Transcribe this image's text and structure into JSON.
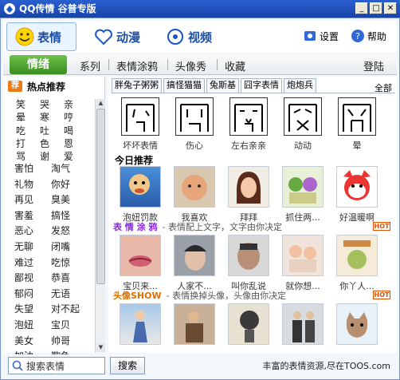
{
  "window": {
    "title": "QQ传情 谷普专版"
  },
  "nav": {
    "tabs": [
      "表情",
      "动漫",
      "视频"
    ],
    "settings": "设置",
    "help": "帮助"
  },
  "categories": {
    "active": "情绪",
    "items": [
      "系列",
      "表情涂鸦",
      "头像秀",
      "收藏"
    ],
    "login": "登陆"
  },
  "sidebar": {
    "badge": "荐",
    "title": "热点推荐",
    "grid3": [
      [
        "笑",
        "哭",
        "亲"
      ],
      [
        "晕",
        "寒",
        "哼"
      ],
      [
        "吃",
        "吐",
        "喝"
      ],
      [
        "打",
        "色",
        "恩"
      ],
      [
        "骂",
        "谢",
        "爱"
      ]
    ],
    "grid2": [
      [
        "害怕",
        "淘气"
      ],
      [
        "礼物",
        "你好"
      ],
      [
        "再见",
        "臭美"
      ],
      [
        "害羞",
        "搞怪"
      ],
      [
        "恶心",
        "发怒"
      ],
      [
        "无聊",
        "闭嘴"
      ],
      [
        "难过",
        "吃惊"
      ],
      [
        "鄙视",
        "恭喜"
      ],
      [
        "郁闷",
        "无语"
      ],
      [
        "失望",
        "对不起"
      ],
      [
        "泡妞",
        "宝贝"
      ],
      [
        "美女",
        "帅哥"
      ],
      [
        "加油",
        "欺负"
      ]
    ]
  },
  "content": {
    "subtabs": [
      "胖兔子粥粥",
      "搞怪猫猫",
      "兔斯基",
      "囧字表情",
      "炮炮兵"
    ],
    "all": "全部",
    "iconrow": [
      "坏坏表情",
      "伤心",
      "左右亲亲",
      "动动",
      "晕"
    ],
    "today_title": "今日推荐",
    "today": [
      "泡妞罚款",
      "我喜欢",
      "拜拜",
      "抓住两...",
      "好温暖啊"
    ],
    "section1": {
      "name": "表 情 涂 鸦",
      "desc": "- 表情配上文字，文字由你决定",
      "hot": "HOT"
    },
    "row2": [
      "宝贝来...",
      "人家不...",
      "叫你乱说",
      "就你想...",
      "你丫人..."
    ],
    "section2": {
      "name": "头像SHOW",
      "desc": "- 表情换掉头像，头像由你决定",
      "hot": "HOT"
    }
  },
  "bottom": {
    "search_placeholder": "搜索表情",
    "search_button": "搜索",
    "footer": "丰富的表情资源,尽在TOOS.com"
  }
}
